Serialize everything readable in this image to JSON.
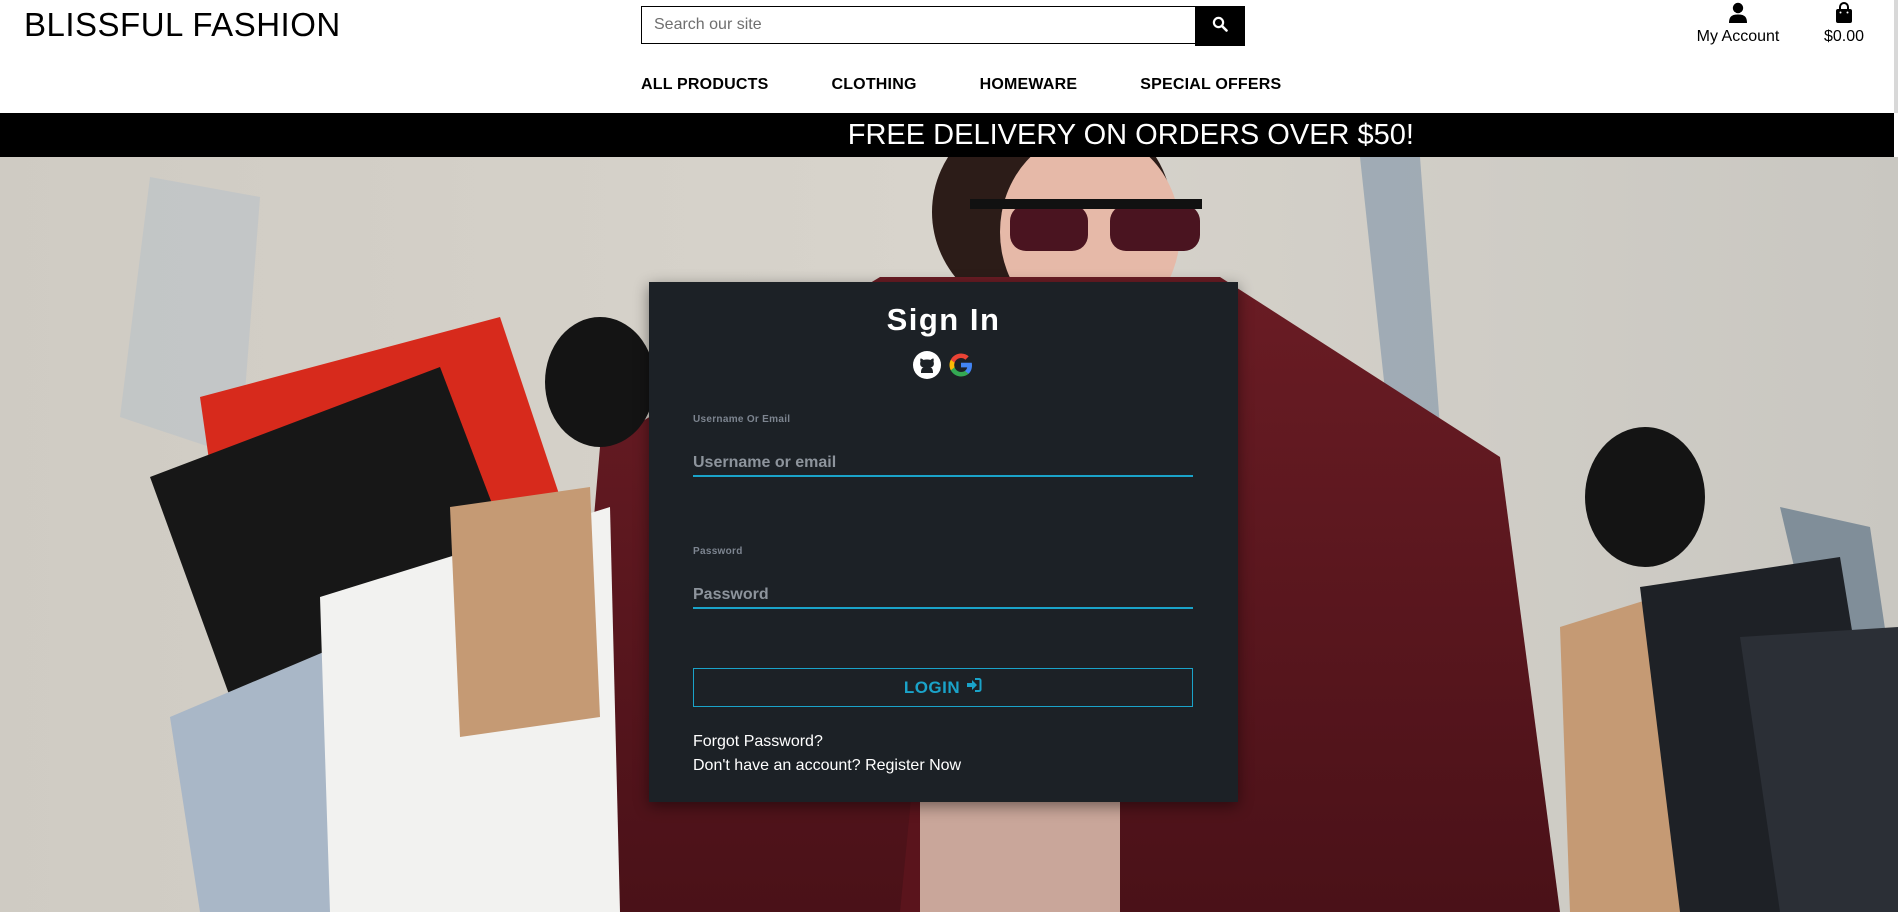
{
  "header": {
    "brand": "BLISSFUL FASHION",
    "search": {
      "placeholder": "Search our site",
      "value": ""
    },
    "account_label": "My Account",
    "bag_total": "$0.00",
    "nav": [
      "ALL PRODUCTS",
      "CLOTHING",
      "HOMEWARE",
      "SPECIAL OFFERS"
    ]
  },
  "banner": {
    "text": "FREE DELIVERY ON ORDERS OVER $50!"
  },
  "signin": {
    "title": "Sign In",
    "social": [
      "github-icon",
      "google-icon"
    ],
    "username": {
      "label": "Username Or Email",
      "placeholder": "Username or email",
      "value": ""
    },
    "password": {
      "label": "Password",
      "placeholder": "Password",
      "value": ""
    },
    "login_label": "LOGIN",
    "forgot_label": "Forgot Password?",
    "register_label": "Don't have an account? Register Now"
  },
  "colors": {
    "accent": "#1aa3c9",
    "card_bg": "#1c2126",
    "banner_bg": "#000000"
  },
  "icons": {
    "search": "search-icon",
    "account": "user-icon",
    "bag": "shopping-bag-icon",
    "login": "sign-in-icon"
  }
}
